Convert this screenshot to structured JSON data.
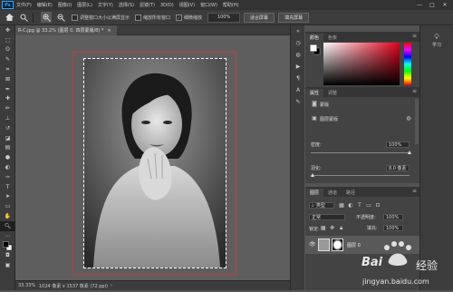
{
  "menu": {
    "logo": "Ps",
    "items": [
      "文件(F)",
      "编辑(E)",
      "图像(I)",
      "图层(L)",
      "文字(Y)",
      "选择(S)",
      "滤镜(T)",
      "3D(D)",
      "视图(V)",
      "窗口(W)",
      "帮助(H)"
    ],
    "window_controls": [
      "—",
      "□",
      "✕"
    ]
  },
  "options": {
    "resize_windows_label": "调整窗口大小以满屏显示",
    "zoom_all_label": "缩放所有窗口",
    "scrubby_zoom_label": "细微缩放",
    "zoom_value": "100%",
    "fit_screen_label": "适合屏幕",
    "fill_screen_label": "填充屏幕"
  },
  "document": {
    "tab_label": "R-C.jpg @ 33.2% (图层 0, 四层蒙版/8) *",
    "tab_close": "✕"
  },
  "status": {
    "zoom": "33.33%",
    "doc_info": "1024 像素 x 1537 像素 (72 ppi)",
    "arrow": "›"
  },
  "panels": {
    "color": {
      "tabs": [
        "颜色",
        "色板"
      ]
    },
    "properties": {
      "tabs": [
        "属性",
        "调整"
      ],
      "mask_type_label": "蒙版",
      "layer_mask_label": "图层蒙版",
      "density_label": "密度:",
      "density_value": "100%",
      "feather_label": "羽化:",
      "feather_value": "8.0 像素"
    },
    "layers": {
      "tabs": [
        "图层",
        "通道",
        "路径"
      ],
      "kind_label": "类型",
      "blend_mode": "正常",
      "opacity_label": "不透明度:",
      "opacity_value": "100%",
      "lock_label": "锁定:",
      "fill_label": "填充:",
      "fill_value": "100%",
      "layer_name": "图层 0"
    }
  },
  "learn": {
    "label": "学习"
  },
  "watermark": {
    "brand": "Bai",
    "brand2": "经验",
    "url": "jingyan.baidu.com"
  },
  "colors": {
    "selection_border": "#b84040",
    "spectrum_hue": "#e2001a"
  }
}
